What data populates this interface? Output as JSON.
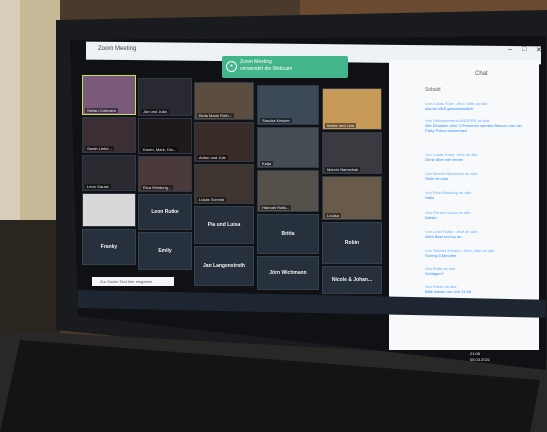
{
  "window": {
    "app_name": "Zoom Meeting"
  },
  "notice": {
    "line1": "Zoom Meeting",
    "line2": "verwendet die Webcam"
  },
  "video_tiles": [
    {
      "name": "Stefan Gutmann"
    },
    {
      "name": "Jan und Julia"
    },
    {
      "name": "Bella Marie Roth..."
    },
    {
      "name": "Sascha Kessler"
    },
    {
      "name": "Meike und Lina"
    },
    {
      "name": "Sarah Liebe..."
    },
    {
      "name": "Karen, Mark, Dio..."
    },
    {
      "name": "Anton und Jule"
    },
    {
      "name": "Marvin Narrschak"
    },
    {
      "name": "Rica Weldung..."
    },
    {
      "name": "Leon Gauss"
    },
    {
      "name": "Hannah Rolls..."
    },
    {
      "name": "Louisa"
    },
    {
      "name": "Katja"
    },
    {
      "name": "Lukas Schmid"
    }
  ],
  "name_tiles": [
    {
      "name": "Leon Rutke"
    },
    {
      "name": "Pia und Luisa"
    },
    {
      "name": "Britta"
    },
    {
      "name": "Robin"
    },
    {
      "name": "Franky"
    },
    {
      "name": "Emily"
    },
    {
      "name": "Jan Langenstroth"
    },
    {
      "name": "Jörn Wichmann"
    },
    {
      "name": "Nicole & Johan..."
    }
  ],
  "chat": {
    "title": "Chat",
    "subtitle": "Sobald",
    "messages": [
      {
        "from": "Von Lukas Suse: Jetzt, bitte an alle:",
        "text": "das ist UNS geschmacklich"
      },
      {
        "from": "Von Stellvertretend ANDERE an alle:",
        "text": "Alle Einladen über 3 Personen werden Besuch von der Party Police bekommen"
      },
      {
        "from": "Von Lukas Suse: Jetzt an alle:",
        "text": "Ohne Alter wie immer"
      },
      {
        "from": "Von Marvin Nierschak an alle:",
        "text": "Sehe ich klar"
      },
      {
        "from": "Von Rica Weldung an alle:",
        "text": "Hallo"
      },
      {
        "from": "Von Pia und Luisa an alle:",
        "text": "Danke"
      },
      {
        "from": "Von Leon Rutke: Jetzt an alle:",
        "text": "Alles Best und so an"
      },
      {
        "from": "Von Sascha Kessler: Jetzt, bitte an alle:",
        "text": "Sonnig 5 Minuten"
      },
      {
        "from": "Von Britta an alle:",
        "text": "Schlagen?"
      },
      {
        "from": "Von Robin an alle:",
        "text": "Bitte wieder zur Uhr 21:00"
      }
    ]
  },
  "taskbar": {
    "search_placeholder": "Zur Suche Text hier eingeben",
    "time": "21:08",
    "date": "05.03.2021"
  }
}
